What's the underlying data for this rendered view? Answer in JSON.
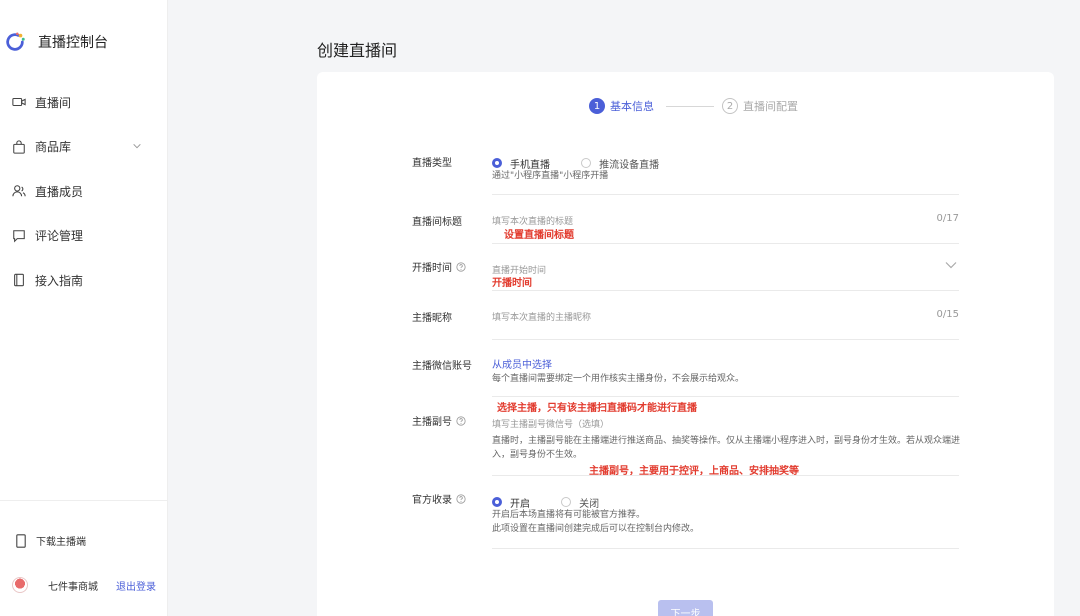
{
  "sidebar": {
    "brand_title": "直播控制台",
    "items": [
      {
        "label": "直播间"
      },
      {
        "label": "商品库"
      },
      {
        "label": "直播成员"
      },
      {
        "label": "评论管理"
      },
      {
        "label": "接入指南"
      }
    ],
    "download_label": "下载主播端",
    "user_name": "七件事商城",
    "logout_label": "退出登录"
  },
  "main": {
    "page_title": "创建直播间",
    "steps": [
      {
        "num": "1",
        "label": "基本信息"
      },
      {
        "num": "2",
        "label": "直播间配置"
      }
    ],
    "form": {
      "live_type": {
        "label": "直播类型",
        "options": [
          "手机直播",
          "推流设备直播"
        ],
        "selected": "手机直播",
        "hint": "通过\"小程序直播\"小程序开播"
      },
      "title": {
        "label": "直播间标题",
        "placeholder": "填写本次直播的标题",
        "counter": "0/17",
        "annotation": "设置直播间标题"
      },
      "start_time": {
        "label": "开播时间",
        "placeholder": "直播开始时间",
        "annotation": "开播时间"
      },
      "nickname": {
        "label": "主播昵称",
        "placeholder": "填写本次直播的主播昵称",
        "counter": "0/15"
      },
      "wechat": {
        "label": "主播微信账号",
        "link": "从成员中选择",
        "hint": "每个直播间需要绑定一个用作核实主播身份，不会展示给观众。",
        "annotation": "选择主播，只有该主播扫直播码才能进行直播"
      },
      "sub_account": {
        "label": "主播副号",
        "placeholder": "填写主播副号微信号（选填）",
        "hint_line1": "直播时，主播副号能在主播端进行推送商品、抽奖等操作。仅从主播端小程序进入时，副号身份才生效。若从观众端进",
        "hint_line2": "入，副号身份不生效。",
        "annotation": "主播副号，主要用于控评，上商品、安排抽奖等"
      },
      "official": {
        "label": "官方收录",
        "options": [
          "开启",
          "关闭"
        ],
        "selected": "开启",
        "hint_line1": "开启后本场直播将有可能被官方推荐。",
        "hint_line2": "此项设置在直播间创建完成后可以在控制台内修改。"
      }
    },
    "next_label": "下一步"
  },
  "colors": {
    "accent": "#4b5fd8",
    "annotation_red": "#e23b2e"
  }
}
